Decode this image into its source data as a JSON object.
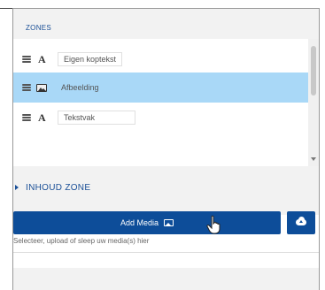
{
  "zones": {
    "title": "ZONES",
    "items": [
      {
        "type_icon": "text-type-icon",
        "label": "Eigen koptekst",
        "selected": false
      },
      {
        "type_icon": "image-icon",
        "label": "Afbeelding",
        "selected": true
      },
      {
        "type_icon": "text-type-icon",
        "label": "Tekstvak",
        "selected": false
      }
    ]
  },
  "inhoud": {
    "title": "INHOUD ZONE",
    "add_media_label": "Add Media",
    "helper_text": "Selecteer, upload of sleep uw media(s) hier"
  },
  "colors": {
    "accent": "#0d4d99",
    "selected_row": "#a9d8f7",
    "section_title": "#1a4f97"
  }
}
